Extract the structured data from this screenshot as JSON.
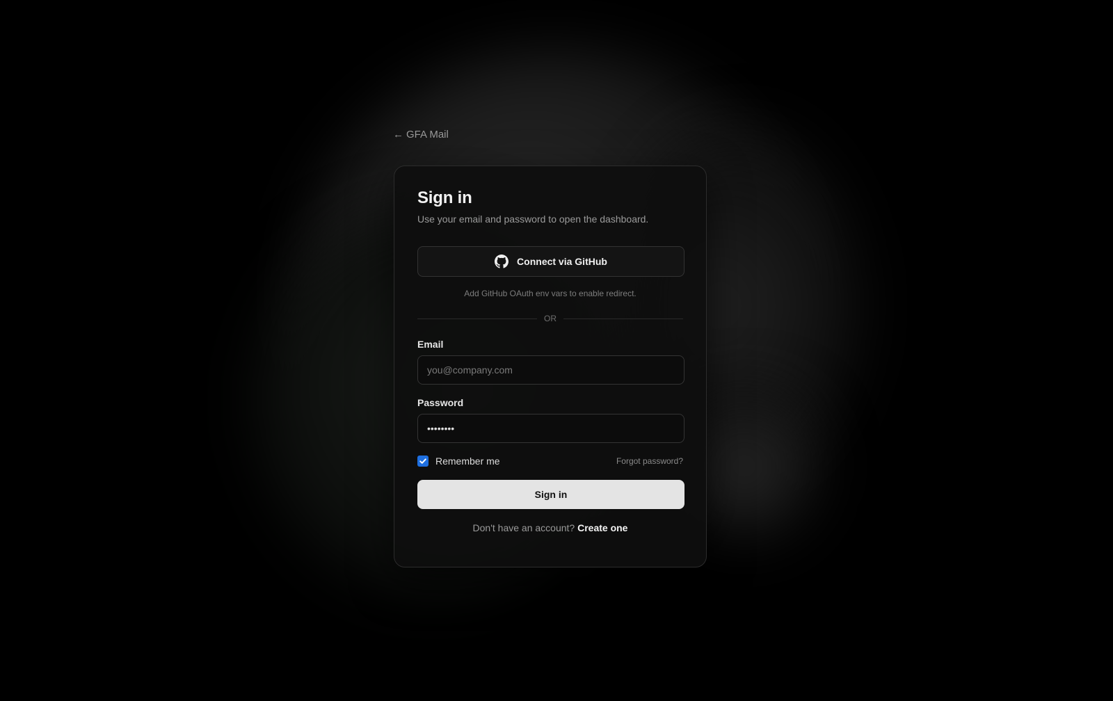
{
  "nav": {
    "back_arrow": "←",
    "back_label": "GFA Mail"
  },
  "card": {
    "title": "Sign in",
    "subtitle": "Use your email and password to open the dashboard.",
    "github_button": {
      "icon": "github-icon",
      "label": "Connect via GitHub"
    },
    "github_hint": "Add GitHub OAuth env vars to enable redirect.",
    "divider_text": "OR",
    "email": {
      "label": "Email",
      "placeholder": "you@company.com",
      "value": ""
    },
    "password": {
      "label": "Password",
      "value": "••••••••"
    },
    "remember": {
      "label": "Remember me",
      "checked": true
    },
    "forgot_label": "Forgot password?",
    "submit_label": "Sign in",
    "signup_prompt": "Don't have an account?",
    "signup_link": "Create one"
  },
  "colors": {
    "background": "#000000",
    "card": "#0e0e0e",
    "accent_checkbox": "#1e6fe0",
    "primary_button": "#e4e4e4"
  }
}
